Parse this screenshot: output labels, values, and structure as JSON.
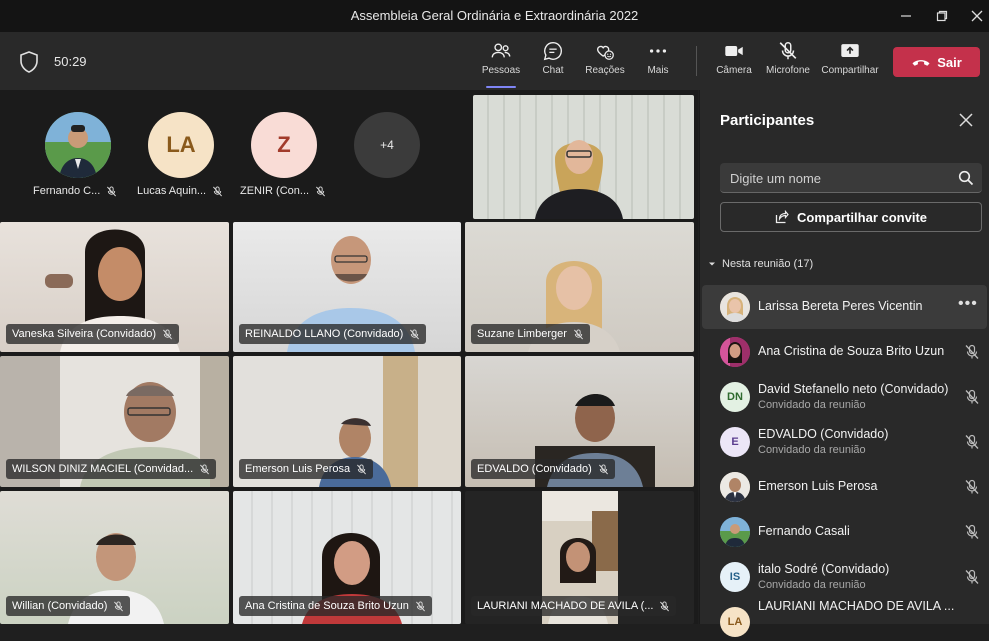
{
  "window": {
    "title": "Assembleia Geral Ordinária e Extraordinária 2022"
  },
  "toolbar": {
    "timer": "50:29",
    "buttons": [
      {
        "label": "Pessoas",
        "icon": "people-icon"
      },
      {
        "label": "Chat",
        "icon": "chat-icon"
      },
      {
        "label": "Reações",
        "icon": "reactions-icon"
      },
      {
        "label": "Mais",
        "icon": "more-icon"
      },
      {
        "label": "Câmera",
        "icon": "camera-icon"
      },
      {
        "label": "Microfone",
        "icon": "mic-off-icon"
      },
      {
        "label": "Compartilhar",
        "icon": "share-icon"
      }
    ],
    "leave_label": "Sair"
  },
  "avatars": [
    {
      "name": "Fernando C...",
      "initials": "",
      "bg": "#3a6ea5"
    },
    {
      "name": "Lucas Aquin...",
      "initials": "LA",
      "bg": "#f6e3c6",
      "fg": "#8a5a1c"
    },
    {
      "name": "ZENIR (Con...",
      "initials": "Z",
      "bg": "#f9dcd6",
      "fg": "#a23b2b"
    },
    {
      "name": "",
      "initials": "+4",
      "bg": "#3b3b3b",
      "fg": "#e8e8e8"
    }
  ],
  "tiles": [
    {
      "name": "Vaneska Silveira (Convidado)"
    },
    {
      "name": "REINALDO LLANO (Convidado)"
    },
    {
      "name": "Suzane Limberger"
    },
    {
      "name": "WILSON DINIZ MACIEL (Convidad..."
    },
    {
      "name": "Emerson Luis Perosa"
    },
    {
      "name": "EDVALDO (Convidado)"
    },
    {
      "name": "Willian (Convidado)"
    },
    {
      "name": "Ana Cristina de Souza Brito Uzun"
    },
    {
      "name": "LAURIANI MACHADO DE AVILA (..."
    }
  ],
  "panel": {
    "title": "Participantes",
    "search_placeholder": "Digite um nome",
    "invite_label": "Compartilhar convite",
    "section_label": "Nesta reunião (17)",
    "participants": [
      {
        "name": "Larissa Bereta Peres Vicentin",
        "sub": "",
        "initials": "",
        "bg": "#d9b48a",
        "selected": true
      },
      {
        "name": "Ana Cristina de Souza Brito Uzun",
        "sub": "",
        "initials": "",
        "bg": "#b0407a"
      },
      {
        "name": "David Stefanello neto (Convidado)",
        "sub": "Convidado da reunião",
        "initials": "DN",
        "bg": "#e3f1e3",
        "fg": "#2e6b2e"
      },
      {
        "name": "EDVALDO (Convidado)",
        "sub": "Convidado da reunião",
        "initials": "E",
        "bg": "#ece6f7",
        "fg": "#5b3d8f"
      },
      {
        "name": "Emerson Luis Perosa",
        "sub": "",
        "initials": "",
        "bg": "#c8b49a"
      },
      {
        "name": "Fernando Casali",
        "sub": "",
        "initials": "",
        "bg": "#3a6ea5"
      },
      {
        "name": "italo Sodré (Convidado)",
        "sub": "Convidado da reunião",
        "initials": "IS",
        "bg": "#e6f1f8",
        "fg": "#25618a"
      },
      {
        "name": "LAURIANI MACHADO DE AVILA ...",
        "sub": "",
        "initials": "LA",
        "bg": "#f6e3c6",
        "fg": "#8a5a1c"
      }
    ]
  }
}
